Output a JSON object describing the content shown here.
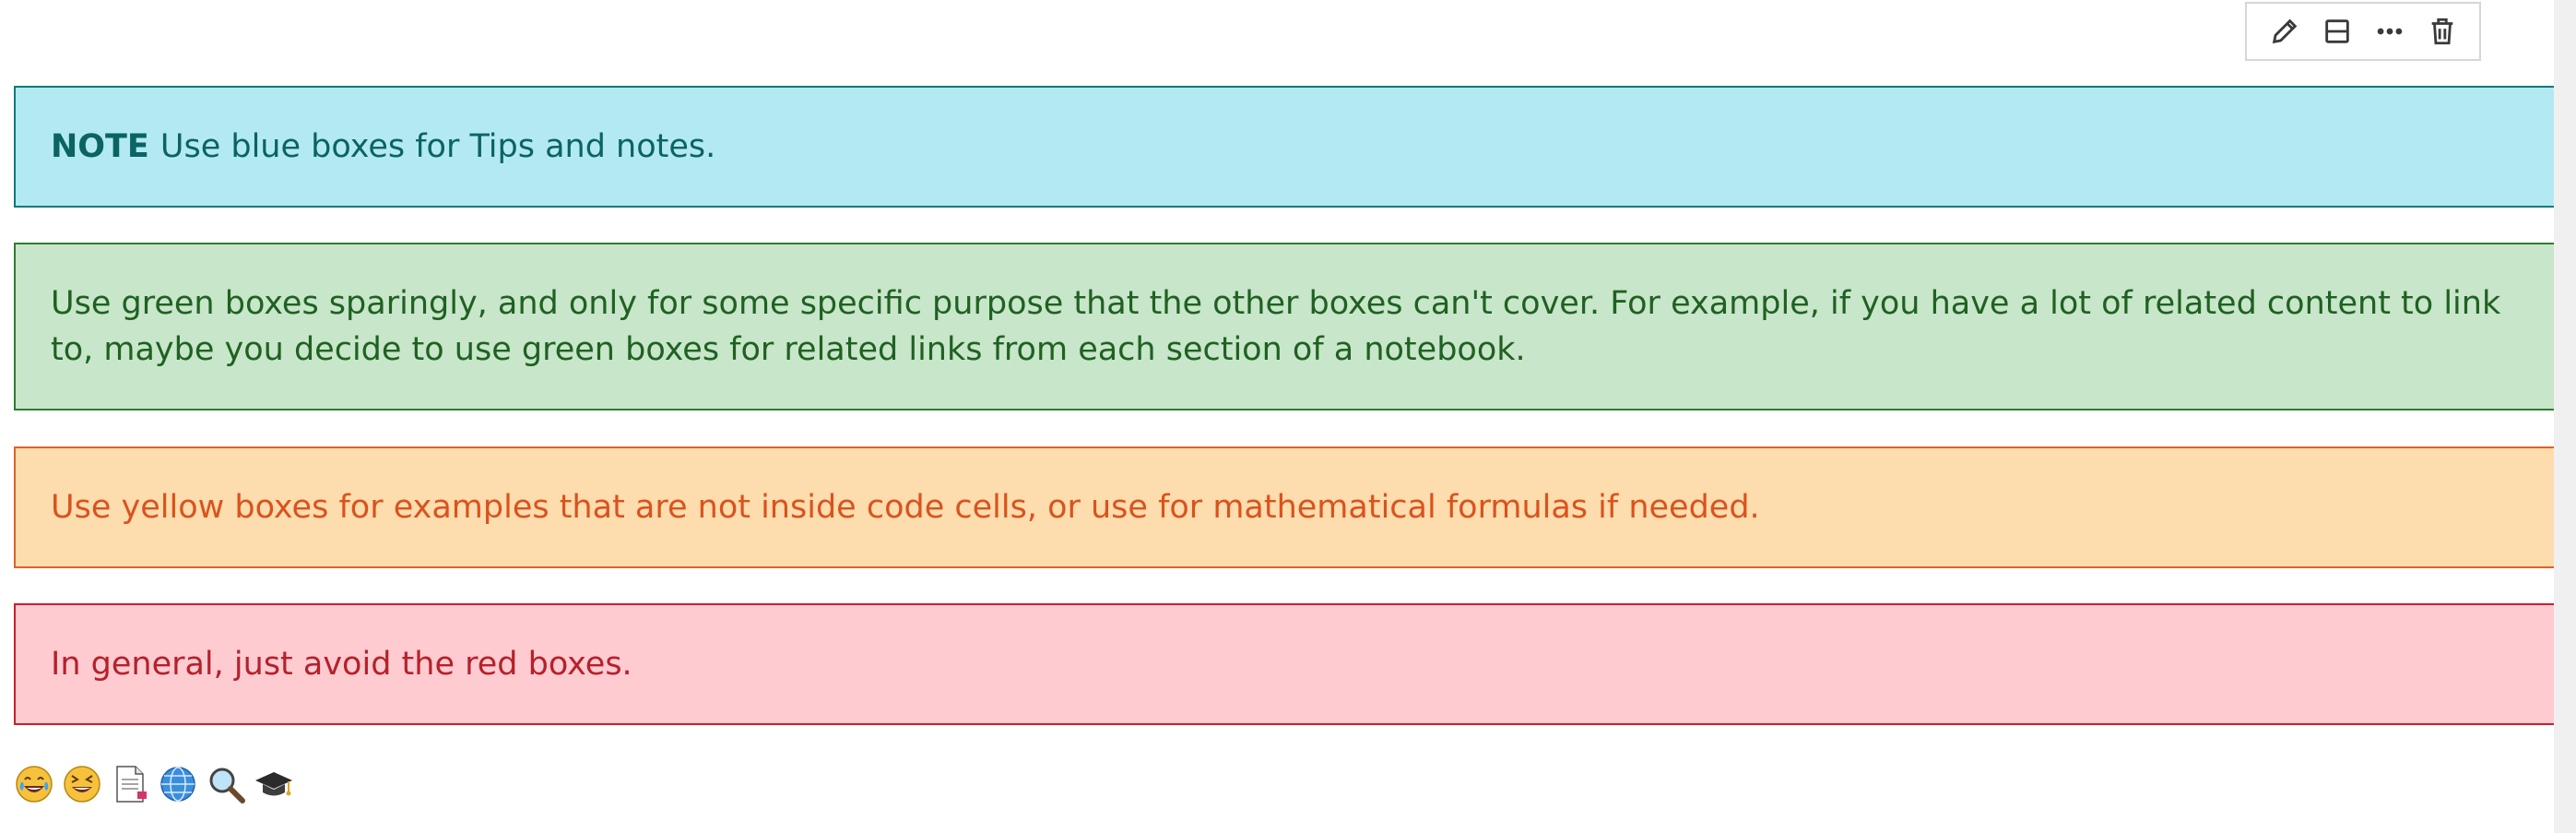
{
  "toolbar": {
    "icons": [
      "pencil-icon",
      "split-cell-icon",
      "more-icon",
      "trash-icon"
    ],
    "more_label": "···"
  },
  "alerts": {
    "info": {
      "label": "NOTE",
      "text": "Use blue boxes for Tips and notes.",
      "color": "#b3eaf2"
    },
    "success": {
      "text": "Use green boxes sparingly, and only for some specific purpose that the other boxes can't cover. For example, if you have a lot of related content to link to, maybe you decide to use green boxes for related links from each section of a notebook.",
      "color": "#c8e6c9"
    },
    "warning": {
      "text": "Use yellow boxes for examples that are not inside code cells, or use for mathematical formulas if needed.",
      "color": "#fddcad"
    },
    "danger": {
      "text": "In general, just avoid the red boxes.",
      "color": "#fecbd1"
    }
  },
  "emojis": [
    "laughing-tears-emoji",
    "grinning-squint-emoji",
    "page-document-emoji",
    "globe-emoji",
    "magnifier-emoji",
    "graduation-cap-emoji"
  ]
}
